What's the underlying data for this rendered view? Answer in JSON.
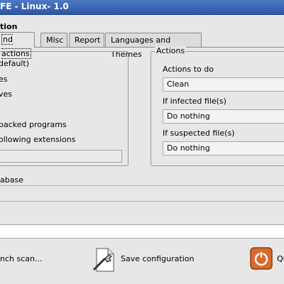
{
  "window": {
    "title": "FE - Linux- 1.0"
  },
  "section_title": "tion",
  "tabs": [
    {
      "label": "nd actions",
      "active": true
    },
    {
      "label": "Misc",
      "active": false
    },
    {
      "label": "Report",
      "active": false
    },
    {
      "label": "Languages and Themes",
      "active": false
    }
  ],
  "scan_options": [
    "default)",
    "es",
    "ves",
    "packed programs",
    "ollowing extensions"
  ],
  "actions": {
    "legend": "Actions",
    "actions_label": "Actions to do",
    "actions_value": "Clean",
    "infected_label": "If infected file(s)",
    "infected_value": "Do nothing",
    "suspected_label": "If suspected file(s)",
    "suspected_value": "Do nothing"
  },
  "database_label": "abase",
  "buttons": {
    "launch_scan": "nch scan...",
    "save_configuration": "Save configuration",
    "quit": "Qu"
  },
  "colors": {
    "titlebar": "#2c57a8",
    "background": "#e7e7e7",
    "quit_icon": "#d86b2c"
  }
}
